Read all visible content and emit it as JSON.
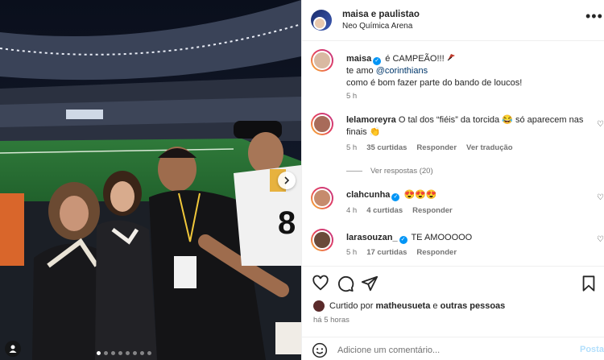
{
  "post": {
    "author": "maisa e paulistao",
    "location": "Neo Química Arena"
  },
  "caption": {
    "username": "maisa",
    "line1": "é CAMPEÃO!!!",
    "line2_prefix": "te amo",
    "mention": "@corinthians",
    "line3": "como é bom fazer parte do bando de loucos!",
    "time": "5 h"
  },
  "comments": [
    {
      "username": "lelamoreyra",
      "text_line1": "O tal dos “fiéis” da torcida 😂 só aparecem nas",
      "text_line2": "finais 👏",
      "time": "5 h",
      "likes": "35 curtidas",
      "reply": "Responder",
      "translate": "Ver tradução",
      "view_replies": "Ver respostas (20)"
    },
    {
      "username": "clahcunha",
      "text": "😍😍😍",
      "time": "4 h",
      "likes": "4 curtidas",
      "reply": "Responder"
    },
    {
      "username": "larasouzan_",
      "text": "TE AMOOOOO",
      "time": "5 h",
      "likes": "17 curtidas",
      "reply": "Responder"
    }
  ],
  "likes_bar": {
    "prefix": "Curtido por",
    "user": "matheusueta",
    "connector": "e",
    "others": "outras pessoas",
    "time": "há 5 horas"
  },
  "comment_box": {
    "placeholder": "Adicione um comentário...",
    "post_label": "Postar"
  },
  "icons": [
    "heart-icon",
    "comment-icon",
    "share-icon",
    "bookmark-icon",
    "emoji-icon",
    "more-icon",
    "chevron-right-icon",
    "user-tag-icon",
    "verified-icon"
  ],
  "colors": {
    "accent": "#0095f6",
    "post_disabled": "#b2dffc",
    "muted": "#737373"
  }
}
